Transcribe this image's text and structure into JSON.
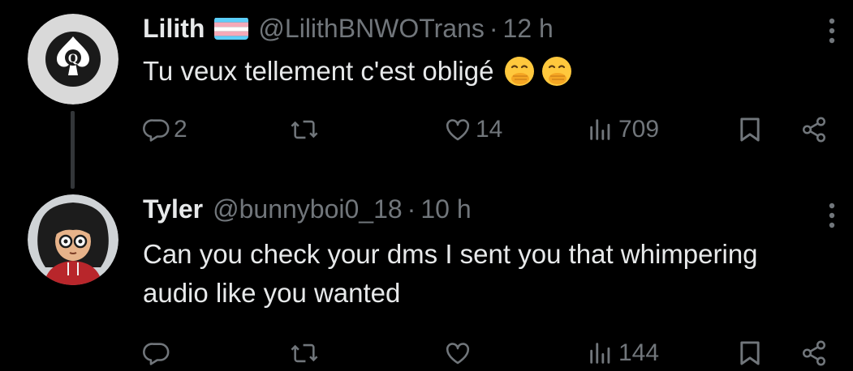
{
  "colors": {
    "background": "#000000",
    "text_primary": "#e7e9ea",
    "text_secondary": "#71767b",
    "thread_line": "#333639"
  },
  "tweets": [
    {
      "display_name": "Lilith",
      "flag_icon": "transgender-flag-icon",
      "handle": "@LilithBNWOTrans",
      "separator": "·",
      "time": "12 h",
      "text": "Tu veux tellement c'est obligé",
      "emoji_icons": [
        "face-with-hand-over-mouth-emoji",
        "face-with-hand-over-mouth-emoji"
      ],
      "stats": {
        "replies": "2",
        "retweets": "",
        "likes": "14",
        "views": "709"
      }
    },
    {
      "display_name": "Tyler",
      "handle": "@bunnyboi0_18",
      "separator": "·",
      "time": "10 h",
      "text": "Can you check your dms I sent you that whimpering audio like you wanted",
      "stats": {
        "replies": "",
        "retweets": "",
        "likes": "",
        "views": "144"
      }
    }
  ]
}
